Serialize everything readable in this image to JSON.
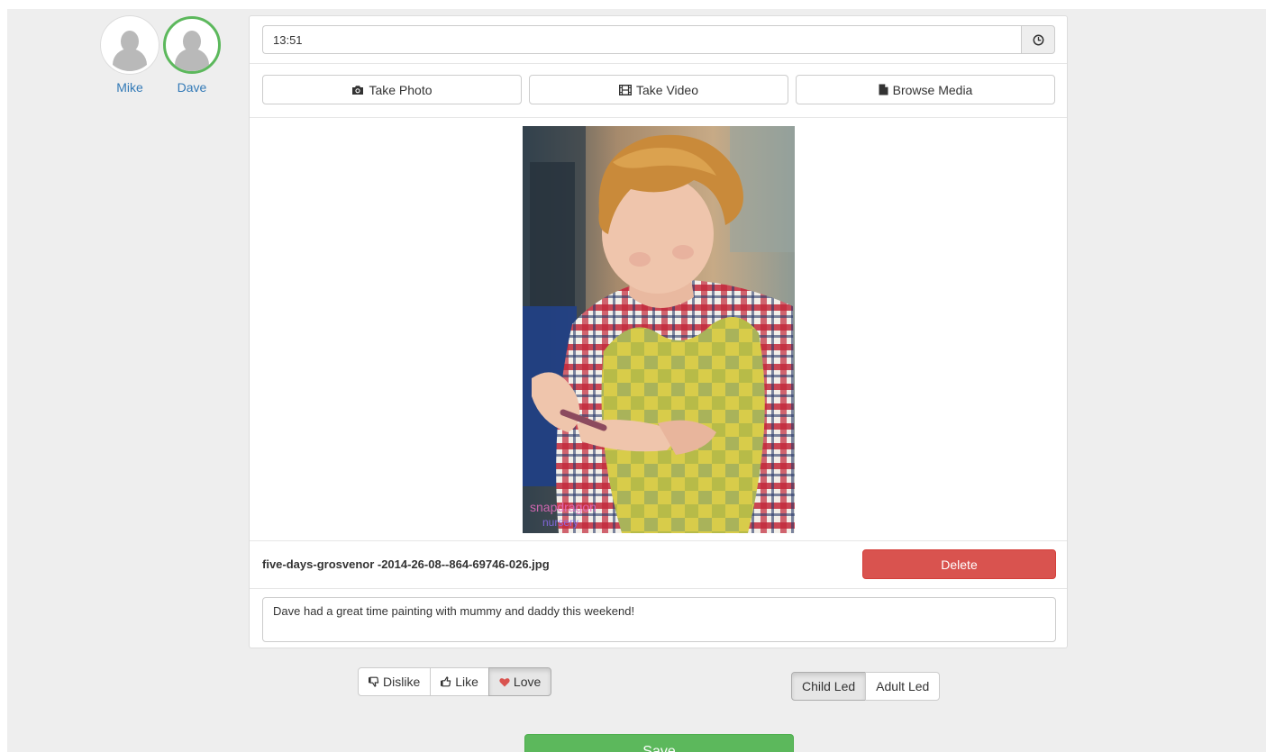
{
  "children": [
    {
      "name": "Mike",
      "selected": false
    },
    {
      "name": "Dave",
      "selected": true
    }
  ],
  "time": {
    "value": "13:51",
    "icon": "clock-icon"
  },
  "media_buttons": {
    "take_photo": {
      "label": "Take Photo",
      "icon": "camera-icon"
    },
    "take_video": {
      "label": "Take Video",
      "icon": "film-icon"
    },
    "browse_media": {
      "label": "Browse Media",
      "icon": "file-icon"
    }
  },
  "photo": {
    "description": "photo"
  },
  "file": {
    "name": "five-days-grosvenor -2014-26-08--864-69746-026.jpg",
    "delete_label": "Delete"
  },
  "comment": {
    "value": "Dave had a great time painting with mummy and daddy this weekend!"
  },
  "reaction": {
    "options": [
      {
        "label": "Dislike",
        "icon": "thumbs-down-icon"
      },
      {
        "label": "Like",
        "icon": "thumbs-up-icon"
      },
      {
        "label": "Love",
        "icon": "heart-icon"
      }
    ],
    "selected": "Love"
  },
  "led": {
    "options": [
      "Child Led",
      "Adult Led"
    ],
    "selected": "Child Led"
  },
  "save_label": "Save",
  "colors": {
    "success": "#5cb85c",
    "danger": "#d9534f",
    "link": "#337ab7",
    "heart": "#d9534f"
  }
}
